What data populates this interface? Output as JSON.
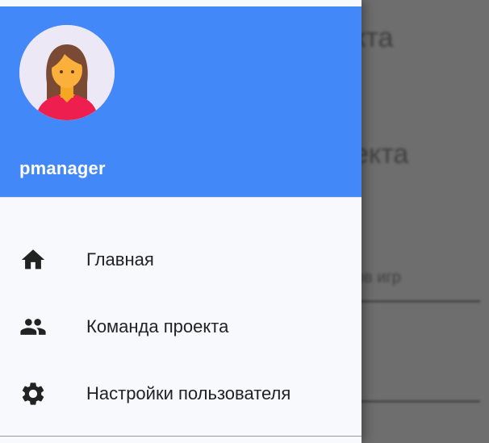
{
  "background": {
    "title_1": "кта",
    "title_2": "екта",
    "caption": "ов игр"
  },
  "drawer": {
    "header_color": "#4388f9",
    "avatar": "female-user-avatar-icon",
    "username": "pmanager"
  },
  "menu": {
    "items": [
      {
        "icon": "home-icon",
        "label": "Главная"
      },
      {
        "icon": "group-icon",
        "label": "Команда проекта"
      },
      {
        "icon": "gear-icon",
        "label": "Настройки пользователя"
      }
    ]
  }
}
